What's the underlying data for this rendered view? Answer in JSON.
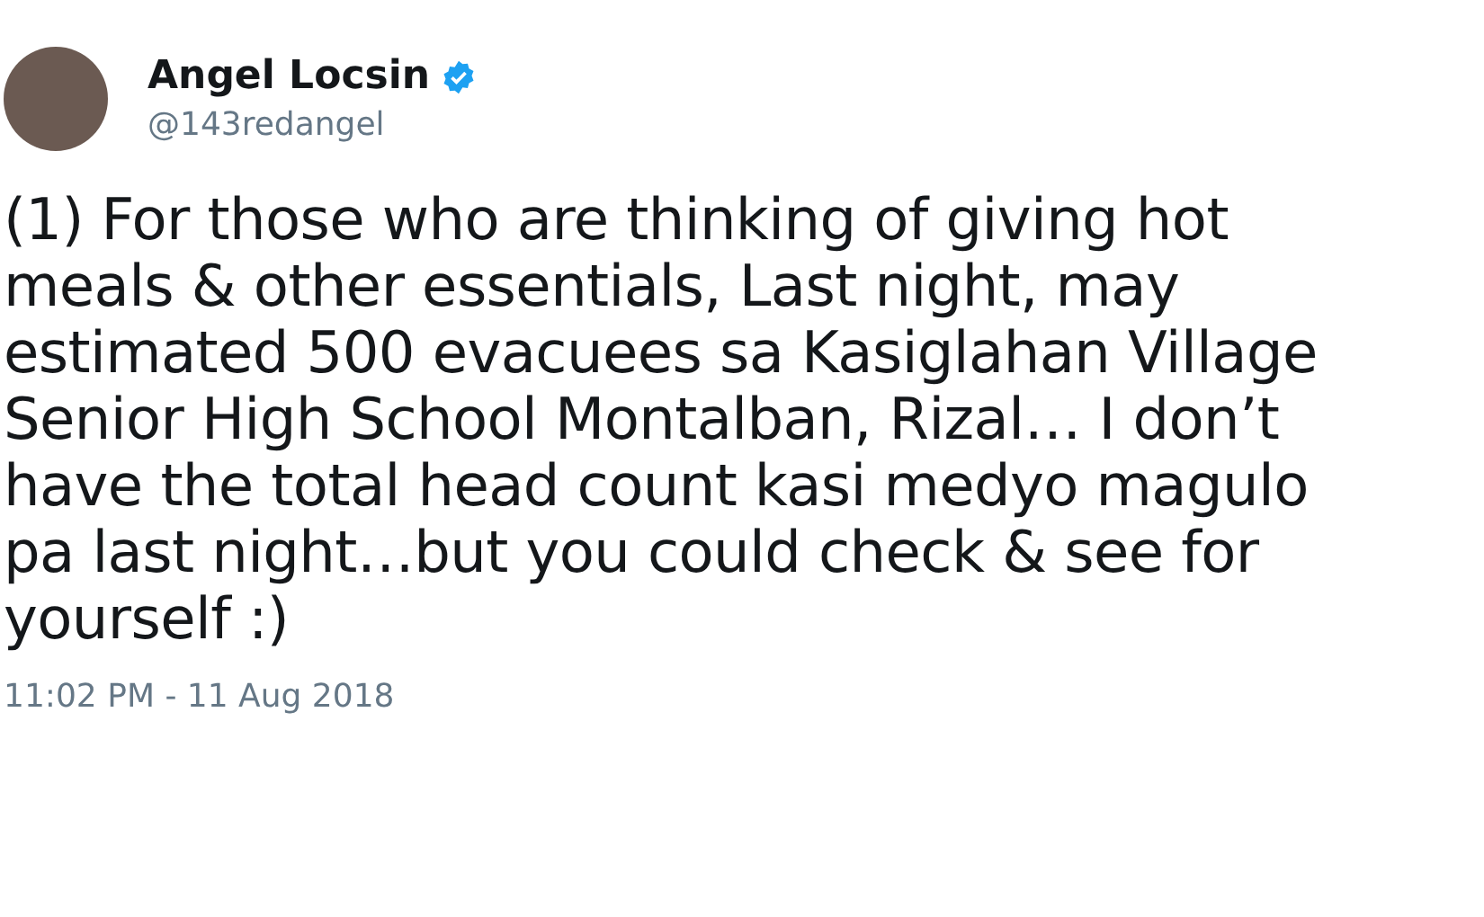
{
  "author": {
    "name": "Angel Locsin",
    "verified": true,
    "handle": "@143redangel"
  },
  "tweet": {
    "text": "(1) For those who are thinking of giving hot\nmeals & other essentials, Last night, may\nestimated 500 evacuees sa Kasiglahan Village\nSenior High School Montalban, Rizal… I don’t\nhave the total head count kasi medyo magulo\npa last night…but you could check & see for\nyourself :)",
    "timestamp": "11:02 PM - 11 Aug 2018"
  }
}
